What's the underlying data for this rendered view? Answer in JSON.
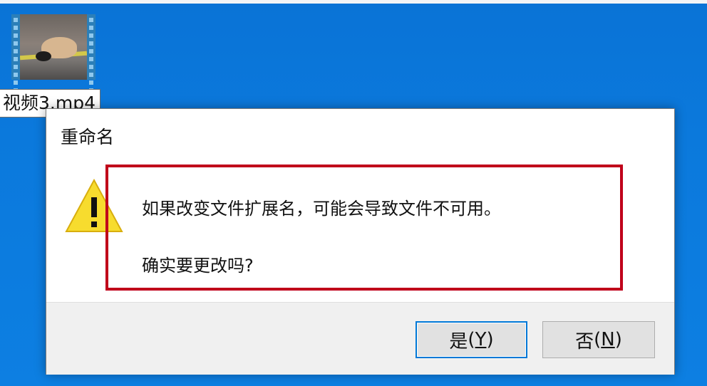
{
  "desktop": {
    "file_label": "视频3.mp4",
    "icon": "video-file-thumbnail-icon"
  },
  "dialog": {
    "title": "重命名",
    "icon": "warning-icon",
    "message_line1": "如果改变文件扩展名，可能会导致文件不可用。",
    "message_line2": "确实要更改吗?",
    "buttons": {
      "yes": {
        "label": "是",
        "hotkey_open": "(",
        "hotkey_key": "Y",
        "hotkey_close": ")"
      },
      "no": {
        "label": "否",
        "hotkey_open": "(",
        "hotkey_key": "N",
        "hotkey_close": ")"
      }
    },
    "highlight_color": "#c0001a",
    "accent": "#0078d7"
  }
}
